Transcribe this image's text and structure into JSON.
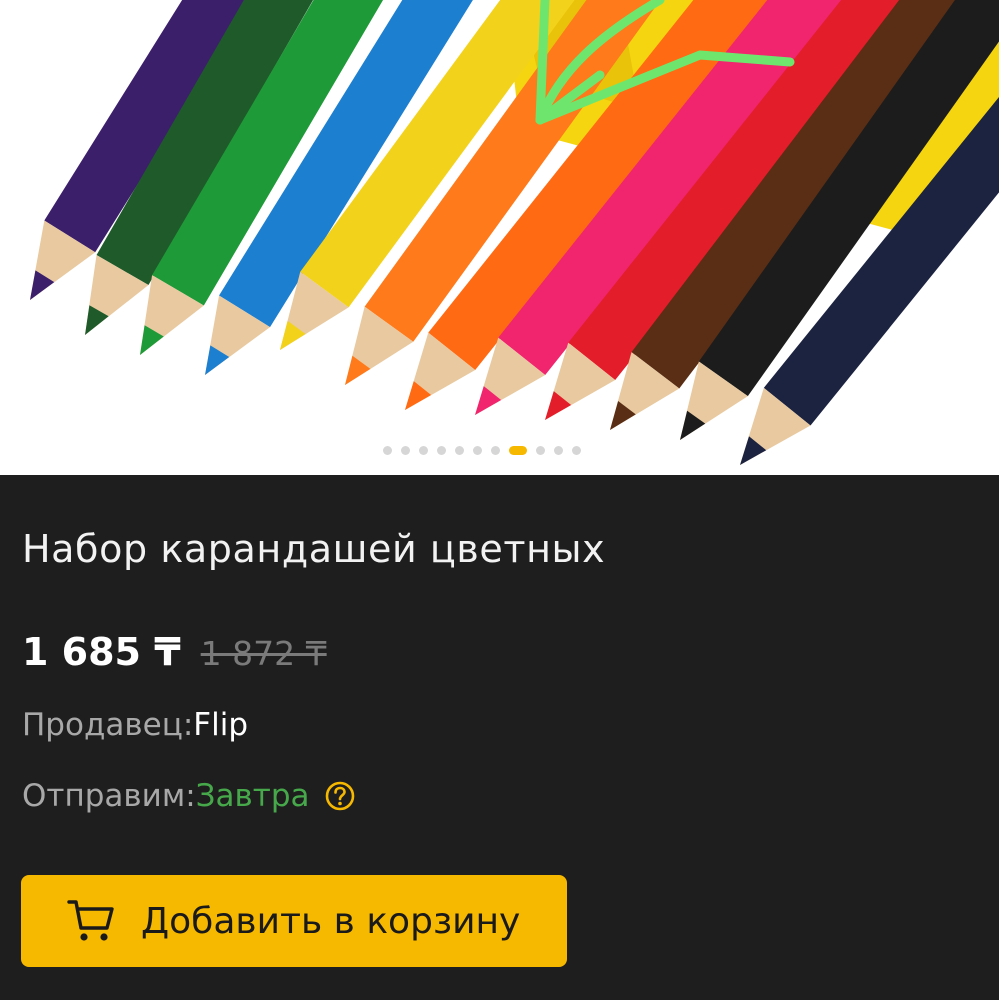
{
  "product": {
    "title": "Набор карандашей цветных",
    "price_current": "1 685 ₸",
    "price_old": "1 872 ₸"
  },
  "seller": {
    "label": "Продавец: ",
    "value": "Flip"
  },
  "shipping": {
    "label": "Отправим: ",
    "value": "Завтра",
    "help_icon": "question-circle-icon"
  },
  "gallery": {
    "image": "colored-pencils-photo",
    "dots_count": 11,
    "active_index": 7
  },
  "cta": {
    "label": "Добавить в корзину",
    "icon": "cart-icon"
  },
  "colors": {
    "accent": "#f7b800",
    "background": "#1e1e1e",
    "shipping_green": "#46a84a",
    "annotation_green": "#6ee66e"
  }
}
